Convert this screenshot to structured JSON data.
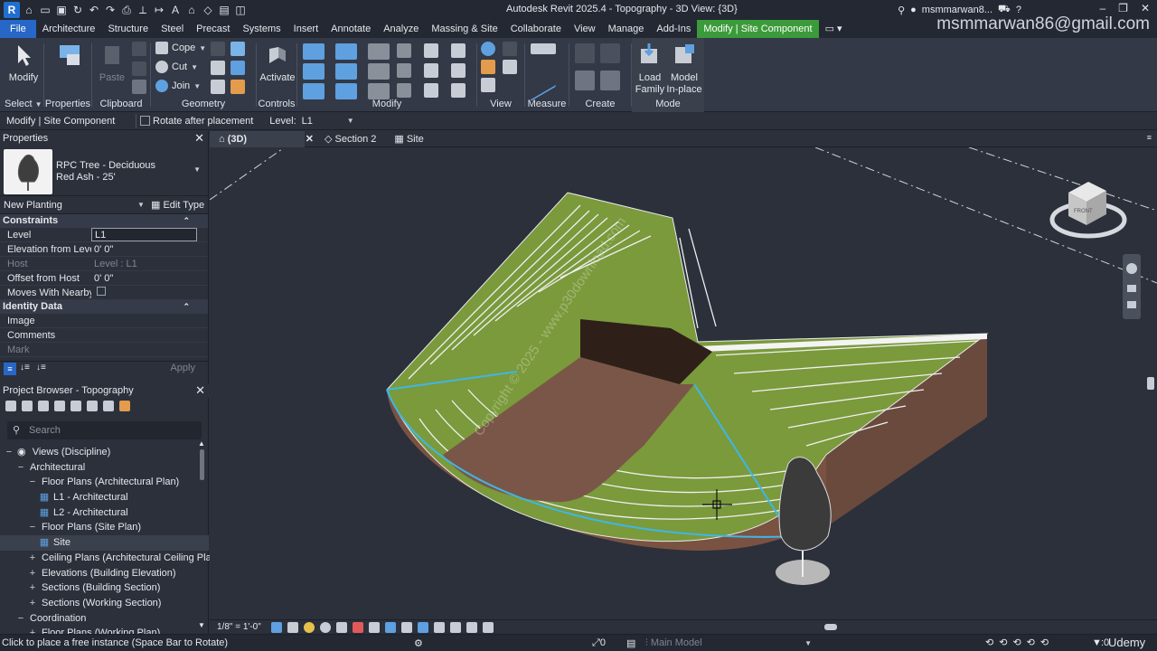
{
  "window": {
    "title": "Autodesk Revit 2025.4 - Topography - 3D View: {3D}",
    "user": "msmmarwan8...",
    "watermark_email": "msmmarwan86@gmail.com"
  },
  "tabs": [
    "File",
    "Architecture",
    "Structure",
    "Steel",
    "Precast",
    "Systems",
    "Insert",
    "Annotate",
    "Analyze",
    "Massing & Site",
    "Collaborate",
    "View",
    "Manage",
    "Add-Ins",
    "Modify | Site Component"
  ],
  "ribbon": {
    "modify": "Modify",
    "properties": "Properties",
    "paste": "Paste",
    "cope": "Cope",
    "cut": "Cut",
    "join": "Join",
    "activate": "Activate",
    "load_family": "Load\nFamily",
    "load_family_l1": "Load",
    "load_family_l2": "Family",
    "model_inplace_l1": "Model",
    "model_inplace_l2": "In-place",
    "panels": {
      "select": "Select",
      "properties": "Properties",
      "clipboard": "Clipboard",
      "geometry": "Geometry",
      "controls": "Controls",
      "modify": "Modify",
      "view": "View",
      "measure": "Measure",
      "create": "Create",
      "mode": "Mode"
    }
  },
  "options_bar": {
    "context": "Modify | Site Component",
    "rotate_label": "Rotate after placement",
    "level_label": "Level:",
    "level_value": "L1"
  },
  "properties": {
    "title": "Properties",
    "family": "RPC Tree - Deciduous",
    "type": "Red Ash - 25'",
    "instance_filter": "New Planting",
    "edit_type": "Edit Type",
    "sections": [
      {
        "name": "Constraints",
        "rows": [
          {
            "k": "Level",
            "v": "L1"
          },
          {
            "k": "Elevation from Level",
            "v": "0'  0\""
          },
          {
            "k": "Host",
            "v": "Level : L1"
          },
          {
            "k": "Offset from Host",
            "v": "0'  0\""
          },
          {
            "k": "Moves With Nearby...",
            "v": ""
          }
        ]
      },
      {
        "name": "Identity Data",
        "rows": [
          {
            "k": "Image",
            "v": ""
          },
          {
            "k": "Comments",
            "v": ""
          },
          {
            "k": "Mark",
            "v": ""
          }
        ]
      }
    ],
    "apply": "Apply"
  },
  "project_browser": {
    "title": "Project Browser - Topography",
    "search_placeholder": "Search",
    "items": [
      {
        "label": "Views (Discipline)",
        "indent": 0,
        "glyph": "−"
      },
      {
        "label": "Architectural",
        "indent": 1,
        "glyph": "−"
      },
      {
        "label": "Floor Plans (Architectural Plan)",
        "indent": 2,
        "glyph": "−"
      },
      {
        "label": "L1 - Architectural",
        "indent": 3,
        "glyph": ""
      },
      {
        "label": "L2 - Architectural",
        "indent": 3,
        "glyph": ""
      },
      {
        "label": "Floor Plans (Site Plan)",
        "indent": 2,
        "glyph": "−"
      },
      {
        "label": "Site",
        "indent": 3,
        "glyph": ""
      },
      {
        "label": "Ceiling Plans (Architectural Ceiling Pla",
        "indent": 2,
        "glyph": "+"
      },
      {
        "label": "Elevations (Building Elevation)",
        "indent": 2,
        "glyph": "+"
      },
      {
        "label": "Sections (Building Section)",
        "indent": 2,
        "glyph": "+"
      },
      {
        "label": "Sections (Working Section)",
        "indent": 2,
        "glyph": "+"
      },
      {
        "label": "Coordination",
        "indent": 1,
        "glyph": "−"
      },
      {
        "label": "Floor Plans (Working Plan)",
        "indent": 2,
        "glyph": "+"
      }
    ]
  },
  "view_tabs": [
    {
      "label": "(3D)"
    },
    {
      "label": "Section 2"
    },
    {
      "label": "Site"
    }
  ],
  "view_bar": {
    "scale": "1/8\" = 1'-0\""
  },
  "canvas": {
    "watermark": "Copyright © 2025 - www.p30download.com",
    "viewcube_top": "TOP",
    "viewcube_front": "FRONT",
    "viewcube_right": "RIGHT"
  },
  "status": {
    "hint": "Click to place a free instance (Space Bar to Rotate)",
    "selected_count": "0",
    "model": "Main Model",
    "udemy": "Udemy",
    "filter_count": ":0"
  },
  "colors": {
    "file_tab": "#2767c7",
    "context_tab": "#3b9b3a",
    "terrain_green": "#7a9a3c",
    "earth_brown": "#6a4a3d"
  }
}
